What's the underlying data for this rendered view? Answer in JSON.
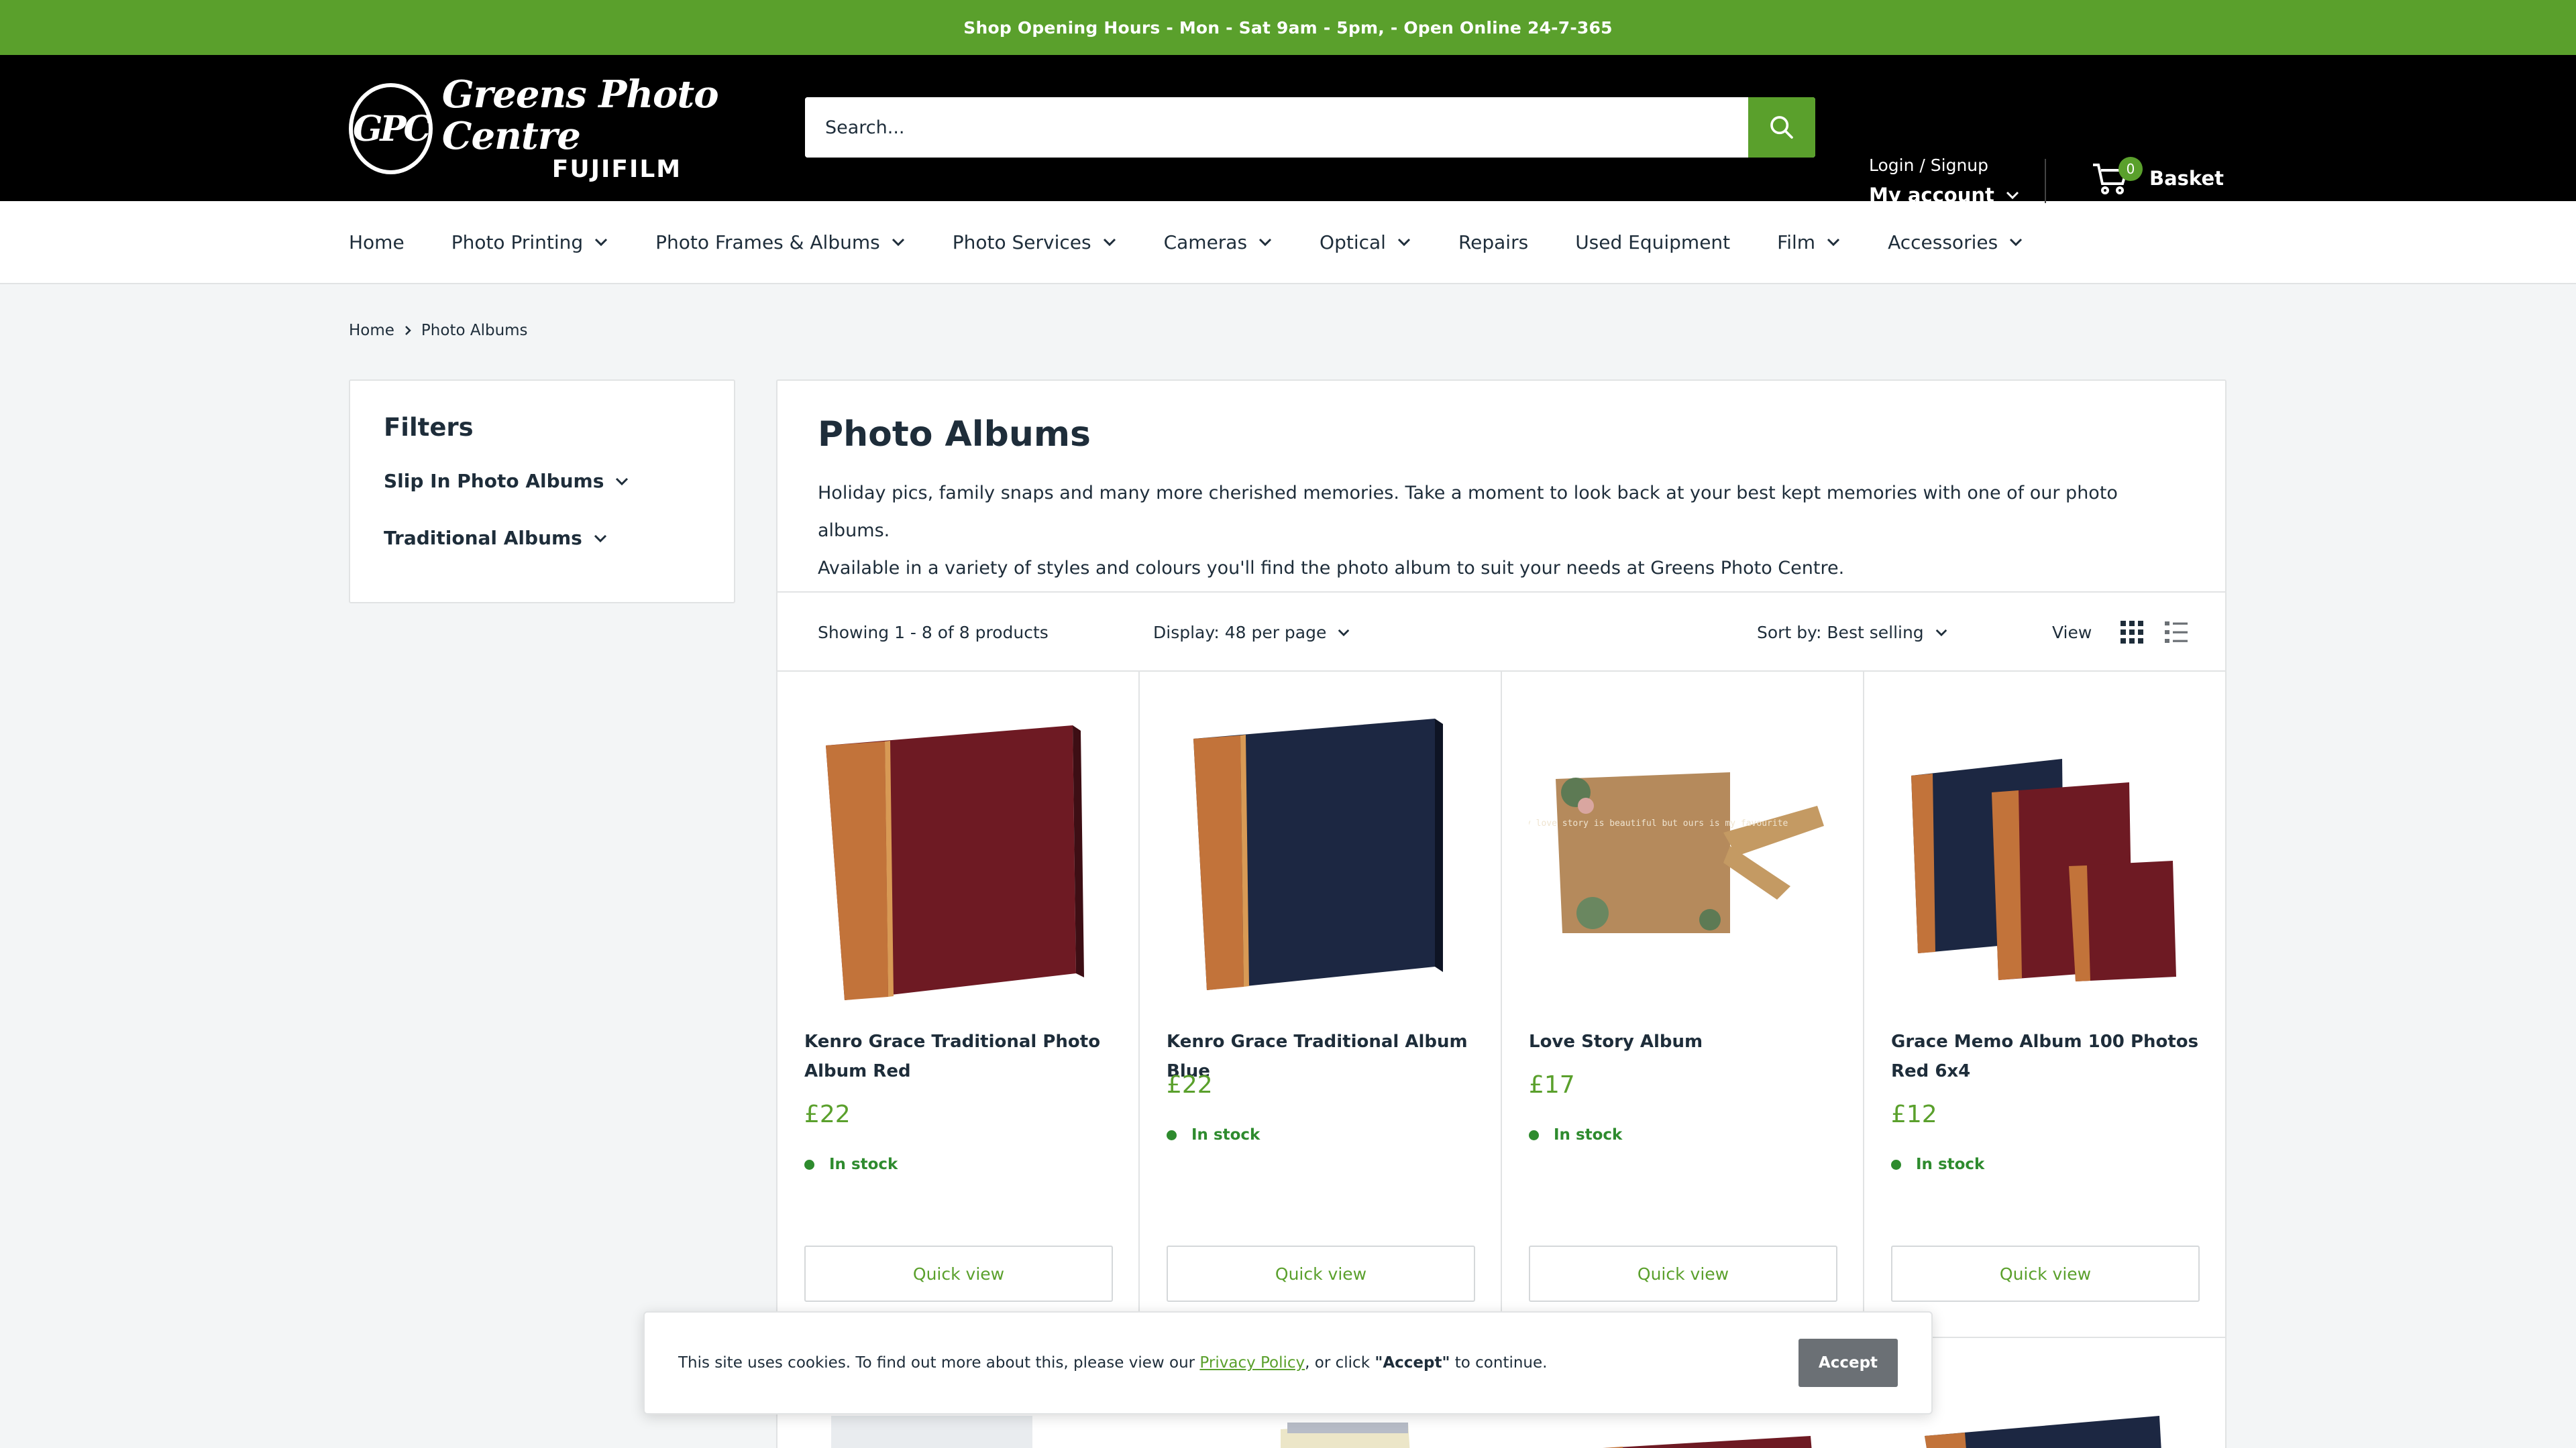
{
  "announcement": "Shop Opening Hours - Mon - Sat 9am - 5pm, - Open Online 24-7-365",
  "header": {
    "logo_initials": "GPC",
    "logo_name": "Greens Photo Centre",
    "logo_brand": "FUJIFILM",
    "search_placeholder": "Search...",
    "login_label": "Login / Signup",
    "account_label": "My account",
    "basket_count": "0",
    "basket_label": "Basket"
  },
  "nav": {
    "items": [
      {
        "label": "Home"
      },
      {
        "label": "Photo Printing"
      },
      {
        "label": "Photo Frames & Albums"
      },
      {
        "label": "Photo Services"
      },
      {
        "label": "Cameras"
      },
      {
        "label": "Optical"
      },
      {
        "label": "Repairs"
      },
      {
        "label": "Used Equipment"
      },
      {
        "label": "Film"
      },
      {
        "label": "Accessories"
      }
    ]
  },
  "breadcrumb": {
    "home": "Home",
    "current": "Photo Albums"
  },
  "filters": {
    "title": "Filters",
    "items": [
      {
        "label": "Slip In Photo Albums"
      },
      {
        "label": "Traditional Albums"
      }
    ]
  },
  "main": {
    "title": "Photo Albums",
    "desc_line1": "Holiday pics, family snaps and many more cherished memories. Take a moment to look back at your best kept memories with one of our photo albums.",
    "desc_line2": "Available in a variety of styles and colours you'll find the photo album to suit your needs at Greens Photo Centre.",
    "showing": "Showing 1 - 8 of 8 products",
    "display": "Display: 48 per page",
    "sort": "Sort by: Best selling",
    "view_label": "View"
  },
  "products": [
    {
      "name": "Kenro Grace Traditional Photo Album Red",
      "price": "£22",
      "stock": "In stock",
      "quick_view": "Quick view"
    },
    {
      "name": "Kenro Grace Traditional Album Blue",
      "price": "£22",
      "stock": "In stock",
      "quick_view": "Quick view"
    },
    {
      "name": "Love Story Album",
      "price": "£17",
      "stock": "In stock",
      "quick_view": "Quick view"
    },
    {
      "name": "Grace Memo Album 100 Photos Red 6x4",
      "price": "£12",
      "stock": "In stock",
      "quick_view": "Quick view"
    }
  ],
  "love_story_cover_text": "every love story is beautiful but ours is my favourite",
  "cookie": {
    "text_before": "This site uses cookies. To find out more about this, please view our ",
    "link": "Privacy Policy",
    "text_mid": ", or click ",
    "accept_quote": "\"Accept\"",
    "text_after": " to continue.",
    "button": "Accept"
  },
  "colors": {
    "brand_green": "#5aa02c",
    "header_bg": "#000000",
    "stock_green": "#2e8b2e",
    "accept_bg": "#6b7075"
  }
}
